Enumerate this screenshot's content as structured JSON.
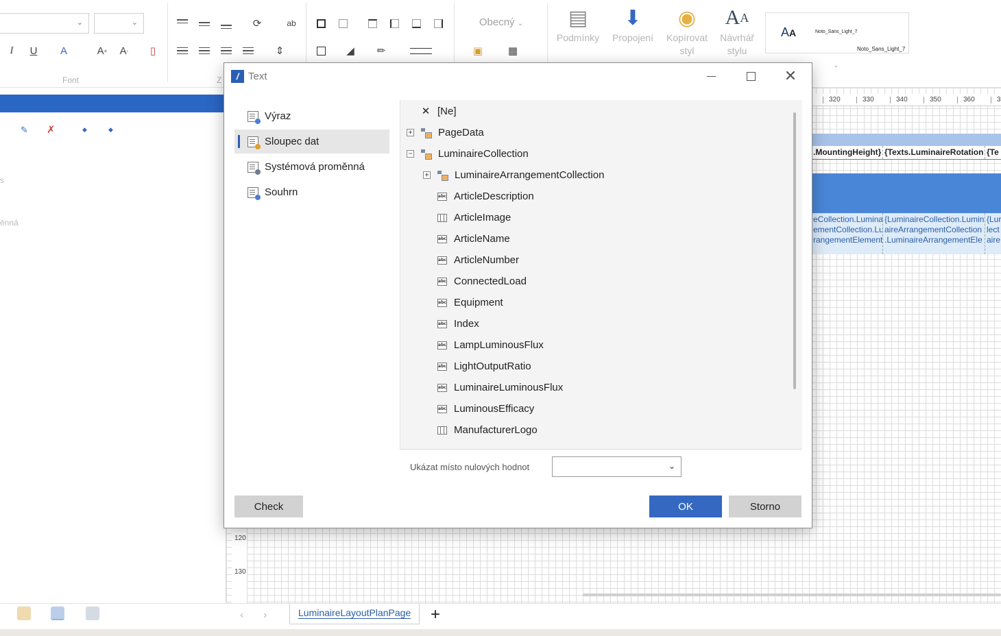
{
  "ribbon": {
    "font_group_label": "Font",
    "align_group_label_partial": "Z",
    "format_value": "Obecný",
    "big_buttons": [
      {
        "id": "conditions",
        "label1": "Podmínky",
        "label2": ""
      },
      {
        "id": "link",
        "label1": "Propojení",
        "label2": ""
      },
      {
        "id": "copy-style",
        "label1": "Kopírovat",
        "label2": "styl"
      },
      {
        "id": "style-designer",
        "label1": "Návrhář",
        "label2": "stylu"
      }
    ],
    "style_preview": {
      "name1": "Noto_Sans_Light_7",
      "name2": "Noto_Sans_Light_7"
    }
  },
  "workspace": {
    "ruler_ticks": [
      "320",
      "330",
      "340",
      "350",
      "360",
      "3"
    ],
    "column_headers": [
      ".MountingHeight}",
      "{Texts.LuminaireRotation",
      "{Te"
    ],
    "data_cells": [
      [
        "eCollection.Luminai",
        "ementCollection.Lu",
        "rangementElement"
      ],
      [
        "{LuminaireCollection.Lumin",
        "aireArrangementCollection",
        ".LuminaireArrangementEle"
      ],
      [
        "{Lur",
        "lect",
        "aire"
      ]
    ],
    "vruler_ticks": [
      "120",
      "130"
    ],
    "left_texts": [
      "s",
      "ěnná"
    ]
  },
  "bottom": {
    "page_tab": "LuminaireLayoutPlanPage",
    "add_tab_symbol": "+"
  },
  "dialog": {
    "title": "Text",
    "nav_items": [
      {
        "label": "Výraz",
        "active": false
      },
      {
        "label": "Sloupec dat",
        "active": true
      },
      {
        "label": "Systémová proměnná",
        "active": false
      },
      {
        "label": "Souhrn",
        "active": false
      }
    ],
    "tree": [
      {
        "label": "[Ne]",
        "icon": "none",
        "level": 0,
        "expander": ""
      },
      {
        "label": "PageData",
        "icon": "collection",
        "level": 0,
        "expander": "+"
      },
      {
        "label": "LuminaireCollection",
        "icon": "collection",
        "level": 0,
        "expander": "−"
      },
      {
        "label": "LuminaireArrangementCollection",
        "icon": "collection",
        "level": 1,
        "expander": "+"
      },
      {
        "label": "ArticleDescription",
        "icon": "text",
        "level": 1,
        "expander": ""
      },
      {
        "label": "ArticleImage",
        "icon": "image",
        "level": 1,
        "expander": ""
      },
      {
        "label": "ArticleName",
        "icon": "text",
        "level": 1,
        "expander": ""
      },
      {
        "label": "ArticleNumber",
        "icon": "text",
        "level": 1,
        "expander": ""
      },
      {
        "label": "ConnectedLoad",
        "icon": "text",
        "level": 1,
        "expander": ""
      },
      {
        "label": "Equipment",
        "icon": "text",
        "level": 1,
        "expander": ""
      },
      {
        "label": "Index",
        "icon": "text",
        "level": 1,
        "expander": ""
      },
      {
        "label": "LampLuminousFlux",
        "icon": "text",
        "level": 1,
        "expander": ""
      },
      {
        "label": "LightOutputRatio",
        "icon": "text",
        "level": 1,
        "expander": ""
      },
      {
        "label": "LuminaireLuminousFlux",
        "icon": "text",
        "level": 1,
        "expander": ""
      },
      {
        "label": "LuminousEfficacy",
        "icon": "text",
        "level": 1,
        "expander": ""
      },
      {
        "label": "ManufacturerLogo",
        "icon": "image",
        "level": 1,
        "expander": ""
      }
    ],
    "null_label": "Ukázat místo nulových hodnot",
    "null_value": "",
    "buttons": {
      "check": "Check",
      "ok": "OK",
      "cancel": "Storno"
    }
  },
  "colors": {
    "accent": "#3568c0",
    "band_blue": "#4a86d8",
    "band_light": "#deebf8"
  }
}
